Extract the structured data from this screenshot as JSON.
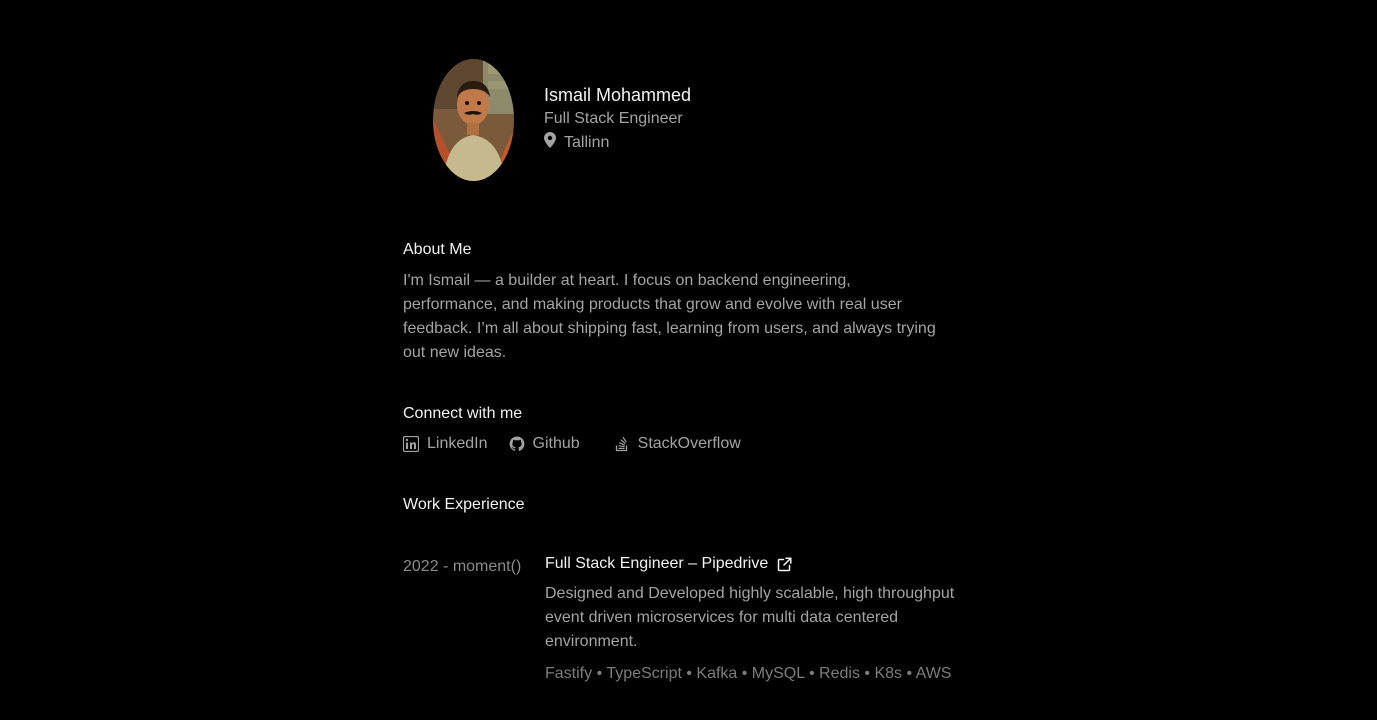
{
  "profile": {
    "name": "Ismail Mohammed",
    "role": "Full Stack Engineer",
    "location": "Tallinn",
    "location_icon": "map-pin-icon"
  },
  "about": {
    "title": "About Me",
    "text": "I'm Ismail — a builder at heart. I focus on backend engineering, performance, and making products that grow and evolve with real user feedback. I’m all about shipping fast, learning from users, and always trying out new ideas."
  },
  "connect": {
    "title": "Connect with me",
    "links": [
      {
        "label": "LinkedIn",
        "icon": "linkedin-icon"
      },
      {
        "label": "Github",
        "icon": "github-icon"
      },
      {
        "label": "StackOverflow",
        "icon": "stackoverflow-icon"
      }
    ]
  },
  "work": {
    "title": "Work Experience",
    "jobs": [
      {
        "period": "2022 - moment()",
        "title": "Full Stack Engineer – Pipedrive",
        "icon": "external-link-icon",
        "description": "Designed and Developed highly scalable, high throughput event driven microservices for multi data centered environment.",
        "tech": "Fastify • TypeScript • Kafka • MySQL • Redis • K8s • AWS"
      }
    ]
  },
  "colors": {
    "background": "#000000",
    "heading": "#f2f2f2",
    "body_text": "#a3a3a3",
    "muted_text": "#7c7c7c"
  }
}
